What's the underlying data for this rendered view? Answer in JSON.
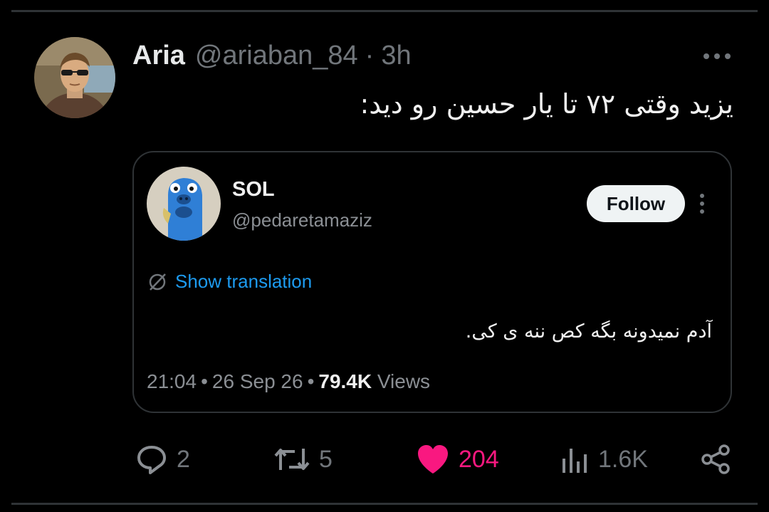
{
  "colors": {
    "background": "#000000",
    "text": "#e7e9ea",
    "muted": "#71767b",
    "link": "#1d9bf0",
    "like": "#f91880",
    "border": "#2f3336"
  },
  "tweet": {
    "author": {
      "display_name": "Aria",
      "handle": "@ariaban_84",
      "separator": "·",
      "time": "3h",
      "avatar_icon": "avatar-photo-man-sunglasses"
    },
    "text": "یزید وقتی ۷۲ تا یار حسین رو دید:",
    "more_icon": "more-horizontal-icon"
  },
  "quote": {
    "author": {
      "display_name": "SOL",
      "handle": "@pedaretamaziz",
      "avatar_icon": "avatar-blue-cartoon-character"
    },
    "follow_label": "Follow",
    "show_translation": "Show translation",
    "text": "آدم نمیدونه بگه کص ننه ی کی.",
    "meta": {
      "time": "21:04",
      "sep": "•",
      "date": "26 Sep 26",
      "views_count": "79.4K",
      "views_label": "Views"
    }
  },
  "actions": {
    "replies": "2",
    "retweets": "5",
    "likes": "204",
    "views": "1.6K",
    "icons": [
      "reply-icon",
      "retweet-icon",
      "like-heart-icon",
      "views-chart-icon",
      "share-icon"
    ]
  }
}
